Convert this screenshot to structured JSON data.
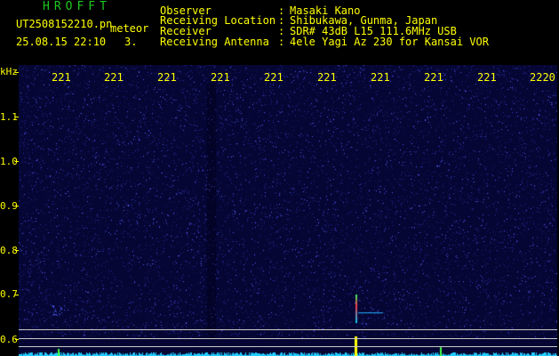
{
  "header": {
    "app_title": "HROFFT",
    "file_name": "UT2508152210.pn",
    "mode_label": "meteor",
    "date_time": "25.08.15 22:10",
    "count": "3.",
    "meta": [
      {
        "key": "Observer",
        "value": "Masaki Kano"
      },
      {
        "key": "Receiving Location",
        "value": "Shibukawa, Gunma, Japan"
      },
      {
        "key": "Receiver",
        "value": "SDR# 43dB L15 111.6MHz USB"
      },
      {
        "key": "Receiving Antenna",
        "value": "4ele Yagi Az 230 for Kansai VOR"
      }
    ],
    "separator": ":"
  },
  "axis": {
    "unit": "kHz",
    "y_labels": [
      "1.1",
      "1.0",
      "0.9",
      "0.8",
      "0.7",
      "0.6"
    ],
    "time_labels": [
      "221",
      "221",
      "221",
      "221",
      "221",
      "221",
      "221",
      "221",
      "221",
      "2220"
    ]
  },
  "colors": {
    "background": "#000000",
    "spectrogram_bg": "#050633",
    "label_yellow": "#ffff00",
    "title_green": "#1ec81e",
    "noise_blue": "#3a3cff",
    "trace_cyan": "#22ccff"
  }
}
